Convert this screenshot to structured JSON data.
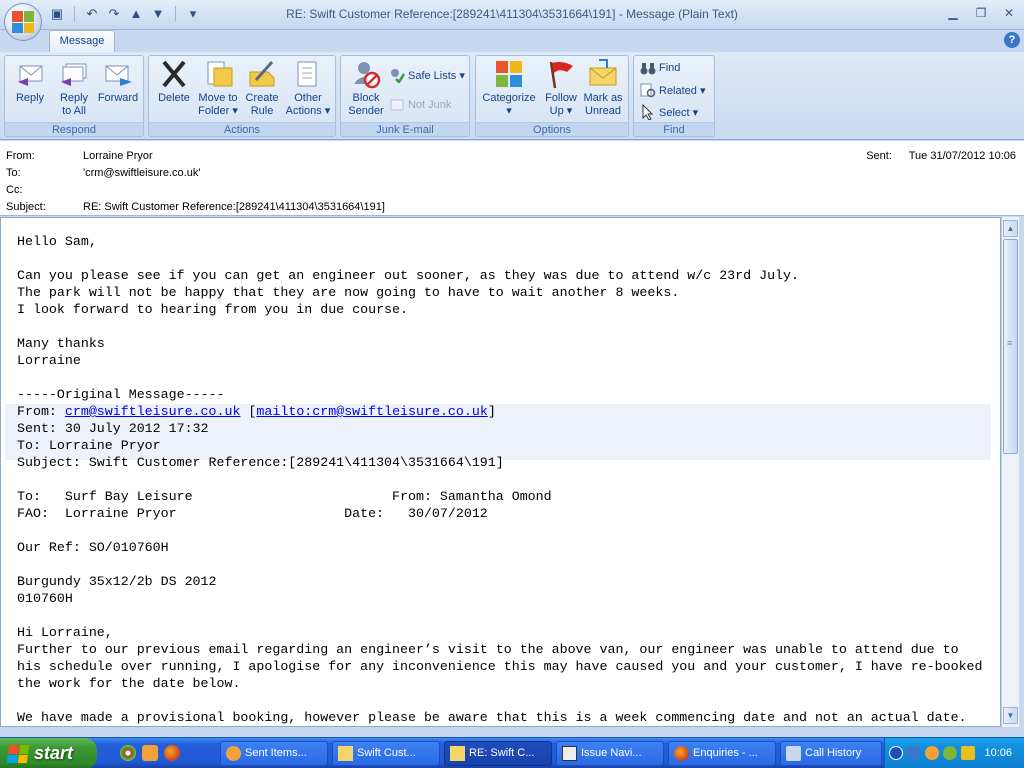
{
  "window": {
    "title": "RE: Swift Customer Reference:[289241\\411304\\3531664\\191] - Message (Plain Text)",
    "help": "?"
  },
  "ribbon": {
    "tab": "Message",
    "groups": {
      "respond": "Respond",
      "actions": "Actions",
      "junk": "Junk E-mail",
      "options": "Options",
      "find": "Find"
    },
    "buttons": {
      "reply": "Reply",
      "reply_all": "Reply\nto All",
      "forward": "Forward",
      "delete": "Delete",
      "move_to_folder": "Move to\nFolder ▾",
      "create_rule": "Create\nRule",
      "other_actions": "Other\nActions ▾",
      "block_sender": "Block\nSender",
      "safe_lists": "Safe Lists ▾",
      "not_junk": "Not Junk",
      "categorize": "Categorize\n▾",
      "follow_up": "Follow\nUp ▾",
      "mark_as_unread": "Mark as\nUnread",
      "find": "Find",
      "related": "Related ▾",
      "select": "Select ▾"
    }
  },
  "header": {
    "from_label": "From:",
    "from": "Lorraine Pryor",
    "to_label": "To:",
    "to": "'crm@swiftleisure.co.uk'",
    "cc_label": "Cc:",
    "cc": "",
    "subject_label": "Subject:",
    "subject": "RE: Swift Customer Reference:[289241\\411304\\3531664\\191]",
    "sent_label": "Sent:",
    "sent": "Tue 31/07/2012 10:06"
  },
  "message": {
    "part1": "Hello Sam,\n\nCan you please see if you can get an engineer out sooner, as they was due to attend w/c 23rd July.\nThe park will not be happy that they are now going to have to wait another 8 weeks.\nI look forward to hearing from you in due course.\n\nMany thanks\nLorraine\n\n-----Original Message-----\nFrom: ",
    "from_link": "crm@swiftleisure.co.uk",
    "bracket_open": " [",
    "mailto_link": "mailto:crm@swiftleisure.co.uk",
    "part2": "]\nSent: 30 July 2012 17:32\nTo: Lorraine Pryor\nSubject: Swift Customer Reference:[289241\\411304\\3531664\\191]\n\nTo:   Surf Bay Leisure                         From: Samantha Omond\nFAO:  Lorraine Pryor                     Date:   30/07/2012\n\nOur Ref: SO/010760H\n\nBurgundy 35x12/2b DS 2012\n010760H\n\nHi Lorraine,\nFurther to our previous email regarding an engineer’s visit to the above van, our engineer was unable to attend due to\nhis schedule over running, I apologise for any inconvenience this may have caused you and your customer, I have re-booked\nthe work for the date below.\n\nWe have made a provisional booking, however please be aware that this is a week commencing date and not an actual date."
  },
  "taskbar": {
    "start": "start",
    "tasks": [
      "Sent Items...",
      "Swift Cust...",
      "RE: Swift C...",
      "Issue Navi...",
      "Enquiries - ...",
      "Call History"
    ],
    "clock": "10:06"
  }
}
